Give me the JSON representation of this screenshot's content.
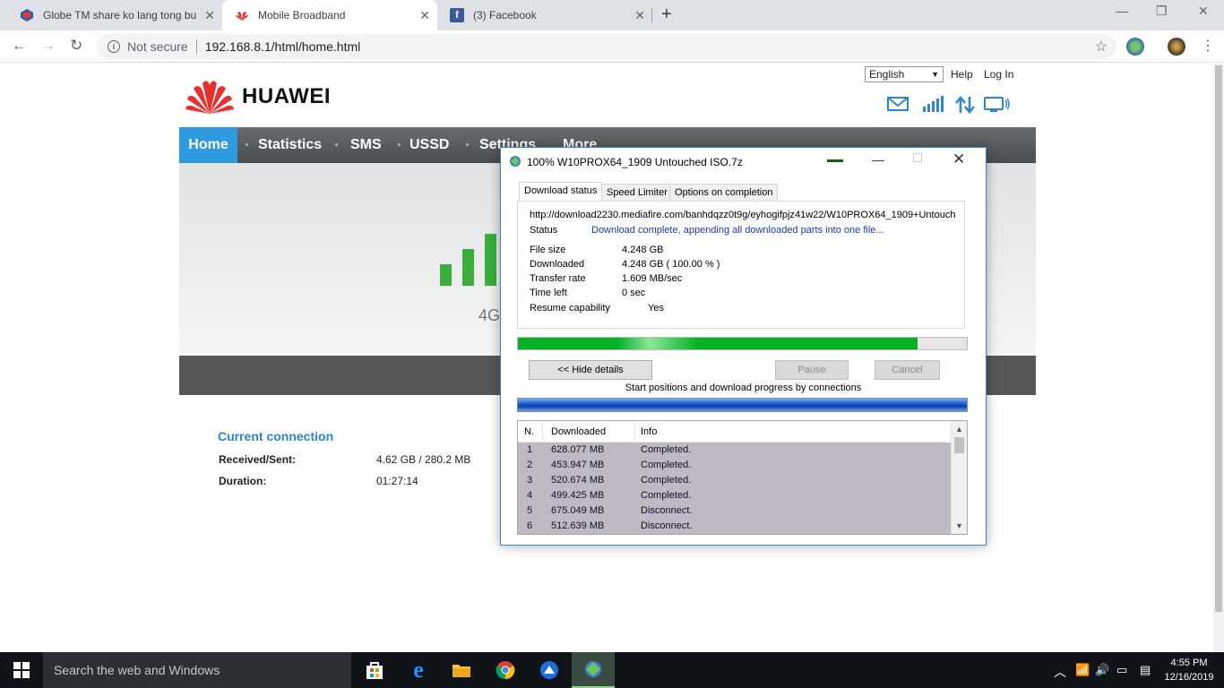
{
  "browser": {
    "tabs": [
      {
        "title": "Globe TM share ko lang tong bu",
        "active": false
      },
      {
        "title": "Mobile Broadband",
        "active": true
      },
      {
        "title": "(3) Facebook",
        "active": false
      }
    ],
    "new_tab": "+",
    "close_glyph": "✕",
    "address": {
      "security_label": "Not secure",
      "url": "192.168.8.1/html/home.html"
    }
  },
  "router_page": {
    "brand": "HUAWEI",
    "language": "English",
    "help": "Help",
    "login": "Log In",
    "nav": [
      "Home",
      "Statistics",
      "SMS",
      "USSD",
      "Settings",
      "More"
    ],
    "network_type": "4G",
    "current_connection": {
      "title": "Current connection",
      "received_sent_label": "Received/Sent:",
      "received_sent_value": "4.62 GB /  280.2 MB",
      "duration_label": "Duration:",
      "duration_value": "01:27:14"
    }
  },
  "idm": {
    "title": "100% W10PROX64_1909 Untouched ISO.7z",
    "tabs": [
      "Download status",
      "Speed Limiter",
      "Options on completion"
    ],
    "url": "http://download2230.mediafire.com/banhdqzz0t9g/eyhogifpjz41w22/W10PROX64_1909+Untouch",
    "status_label": "Status",
    "status_value": "Download complete, appending all downloaded parts into one file...",
    "fields": [
      {
        "label": "File size",
        "value": "4.248  GB"
      },
      {
        "label": "Downloaded",
        "value": "4.248  GB  ( 100.00 % )"
      },
      {
        "label": "Transfer rate",
        "value": "1.609  MB/sec"
      },
      {
        "label": "Time left",
        "value": "0 sec"
      },
      {
        "label": "Resume capability",
        "value": "Yes"
      }
    ],
    "progress_fraction": 0.89,
    "buttons": {
      "hide_details": "<< Hide details",
      "pause": "Pause",
      "cancel": "Cancel"
    },
    "connections_label": "Start positions and download progress by connections",
    "table": {
      "headers": [
        "N.",
        "Downloaded",
        "Info"
      ],
      "rows": [
        {
          "n": "1",
          "downloaded": "628.077  MB",
          "info": "Completed."
        },
        {
          "n": "2",
          "downloaded": "453.947  MB",
          "info": "Completed."
        },
        {
          "n": "3",
          "downloaded": "520.674  MB",
          "info": "Completed."
        },
        {
          "n": "4",
          "downloaded": "499.425  MB",
          "info": "Completed."
        },
        {
          "n": "5",
          "downloaded": "675.049  MB",
          "info": "Disconnect."
        },
        {
          "n": "6",
          "downloaded": "512.639  MB",
          "info": "Disconnect."
        }
      ]
    }
  },
  "taskbar": {
    "search_placeholder": "Search the web and Windows",
    "time": "4:55 PM",
    "date": "12/16/2019"
  },
  "colors": {
    "huawei_red": "#e8312f",
    "nav_active": "#2f9ade",
    "signal_green": "#3aae3a",
    "idm_status_blue": "#1c37a8",
    "progress_green": "#06b025"
  }
}
